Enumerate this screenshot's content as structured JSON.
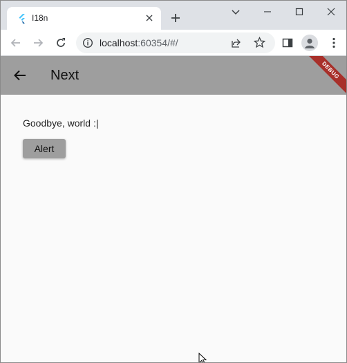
{
  "browser": {
    "tab": {
      "title": "I18n"
    },
    "address_bar": {
      "host": "localhost",
      "rest": ":60354/#/"
    }
  },
  "app": {
    "appbar_title": "Next",
    "debug_banner": "DEBUG",
    "message": "Goodbye, world :|",
    "alert_button": "Alert"
  },
  "colors": {
    "appbar": "#9e9e9e",
    "button": "#9e9e9e",
    "debug_banner": "#a8302a",
    "flutter_logo": "#47c5fb"
  }
}
